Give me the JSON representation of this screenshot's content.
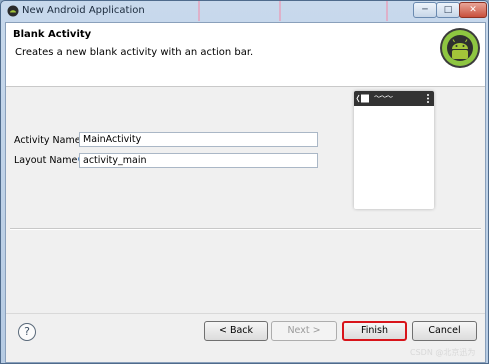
{
  "window": {
    "title": "New Android Application",
    "controls": {
      "minimize": "─",
      "maximize": "□",
      "close": "✕"
    }
  },
  "banner": {
    "title": "Blank Activity",
    "description": "Creates a new blank activity with an action bar."
  },
  "form": {
    "activity_name": {
      "label": "Activity Name",
      "value": "MainActivity"
    },
    "layout_name": {
      "label": "Layout Name",
      "value": "activity_main"
    }
  },
  "preview": {
    "title_glyph": "〜〜〜"
  },
  "footer": {
    "help": "?",
    "back_label": "< Back",
    "next_label": "Next >",
    "finish_label": "Finish",
    "cancel_label": "Cancel"
  },
  "watermark": "CSDN @北京迅为",
  "colors": {
    "android_green": "#8ec641",
    "finish_highlight": "#d8141a",
    "info_dot": "#4b84c9"
  },
  "icons": [
    "app-icon",
    "android-logo",
    "help-icon",
    "info-icon",
    "overflow-menu-icon"
  ]
}
